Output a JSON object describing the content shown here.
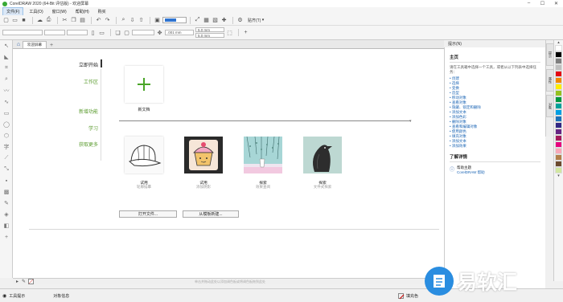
{
  "window": {
    "title": "CorelDRAW 2020 (64-Bit 评估版) - 欢迎屏幕"
  },
  "menu": [
    "文件(F)",
    "工具(O)",
    "窗口(W)",
    "帮助(H)",
    "购买"
  ],
  "toolbar": {
    "snap_label": "贴齐(T)"
  },
  "propbar": {
    "nudge": ".001 mm",
    "dup_x": "5.0 mm",
    "dup_y": "5.0 mm"
  },
  "doc_tabs": [
    "欢迎屏幕"
  ],
  "welcome": {
    "nav_primary": "立即开始",
    "nav_items": [
      "工作区",
      "新增功能",
      "学习",
      "获取更多"
    ],
    "new_doc_label": "新文档",
    "samples": [
      {
        "label": "试用",
        "sublabel": "轮廓描摹"
      },
      {
        "label": "试用",
        "sublabel": "添加阴影"
      },
      {
        "label": "探索",
        "sublabel": "效果查阅"
      },
      {
        "label": "探索",
        "sublabel": "文件式探索"
      }
    ],
    "open_file_button": "打开文件...",
    "from_template_button": "从模板新建...",
    "drag_hint": "单击并拖动此处以添加调色板或将调色板拖到此处"
  },
  "docker": {
    "tab_title": "提示(N)",
    "section_title": "主页",
    "description": "请在工具箱中选择一个工具，或者从以下列表中选择任务：",
    "links": [
      "创建",
      "选择",
      "变换",
      "造型",
      "移动对象",
      "查看对象",
      "隐藏、锁定和删除",
      "添加文本",
      "添加色彩",
      "删除对象",
      "查看和编辑对象",
      "使用颜色",
      "填充对象",
      "添加文本",
      "添加效果"
    ],
    "learn_more_title": "了解详情",
    "help_topic_label": "帮助主题",
    "help_topic_sub": "CorelDRAW 帮助",
    "vertical_tabs": [
      "提示",
      "属性",
      "对象"
    ]
  },
  "palette_colors": [
    "#ffffff",
    "#000000",
    "#7f7f7f",
    "#bfbfbf",
    "#e30613",
    "#f18700",
    "#ffed00",
    "#95c11f",
    "#009640",
    "#00a19a",
    "#009fe3",
    "#1d71b8",
    "#312783",
    "#662483",
    "#a3195b",
    "#e6007e",
    "#f7a8b8",
    "#b17f4a",
    "#6c4a2f",
    "#d1e7a1"
  ],
  "status": {
    "tool_hint": "工具提示",
    "object_info": "对象信息",
    "fill_label": "填充色"
  },
  "watermark": {
    "text": "易软汇"
  }
}
